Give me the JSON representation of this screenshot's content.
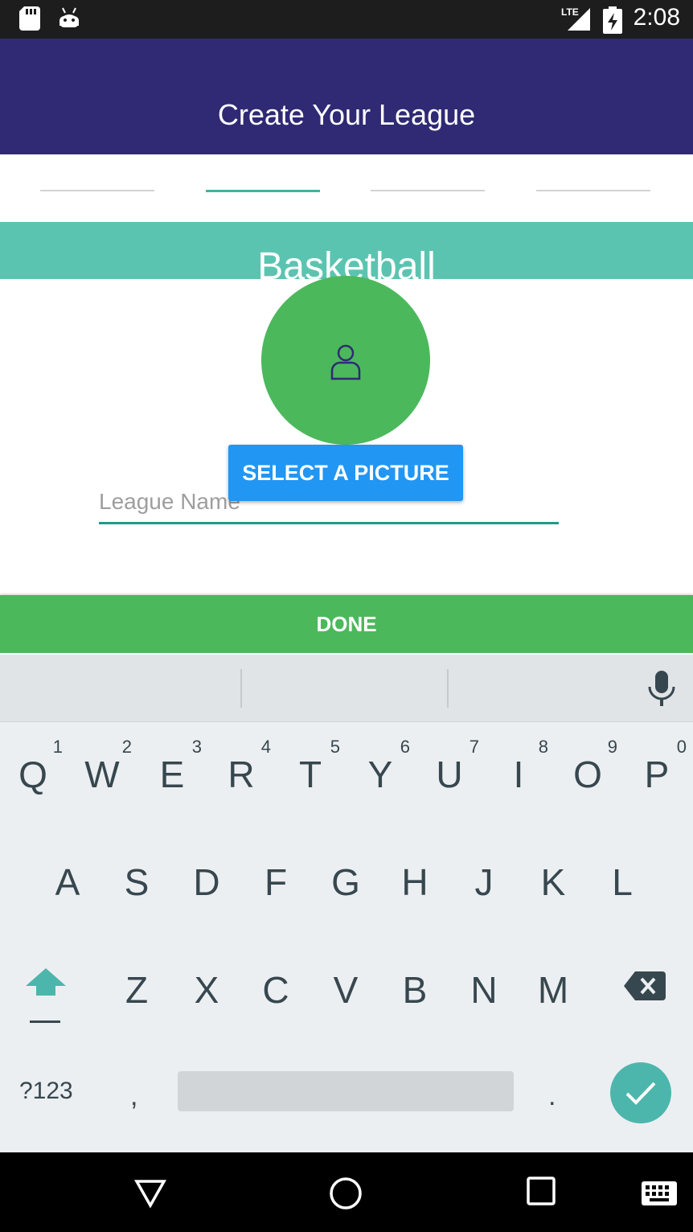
{
  "status_bar": {
    "time": "2:08",
    "icons": [
      "sd-card-icon",
      "android-icon",
      "lte-signal-icon",
      "battery-charging-icon"
    ]
  },
  "app_bar": {
    "title": "Create Your League"
  },
  "stepper": {
    "total_steps": 4,
    "active_step": 2
  },
  "sport_banner": {
    "label": "Basketball"
  },
  "avatar": {
    "icon": "person-icon",
    "color": "#4cb85c"
  },
  "picture_button": {
    "label": "SELECT A PICTURE"
  },
  "league_name": {
    "placeholder": "League Name",
    "value": ""
  },
  "done_button": {
    "label": "DONE"
  },
  "keyboard": {
    "row1": [
      {
        "key": "Q",
        "hint": "1"
      },
      {
        "key": "W",
        "hint": "2"
      },
      {
        "key": "E",
        "hint": "3"
      },
      {
        "key": "R",
        "hint": "4"
      },
      {
        "key": "T",
        "hint": "5"
      },
      {
        "key": "Y",
        "hint": "6"
      },
      {
        "key": "U",
        "hint": "7"
      },
      {
        "key": "I",
        "hint": "8"
      },
      {
        "key": "O",
        "hint": "9"
      },
      {
        "key": "P",
        "hint": "0"
      }
    ],
    "row2": [
      "A",
      "S",
      "D",
      "F",
      "G",
      "H",
      "J",
      "K",
      "L"
    ],
    "row3": [
      "Z",
      "X",
      "C",
      "V",
      "B",
      "N",
      "M"
    ],
    "symbols_label": "?123",
    "comma_label": ",",
    "period_label": "."
  },
  "colors": {
    "app_bar": "#2f2a73",
    "accent": "#3fb4a0",
    "banner": "#5bc4b0",
    "primary_button": "#2196f3",
    "done": "#4cb85c"
  }
}
